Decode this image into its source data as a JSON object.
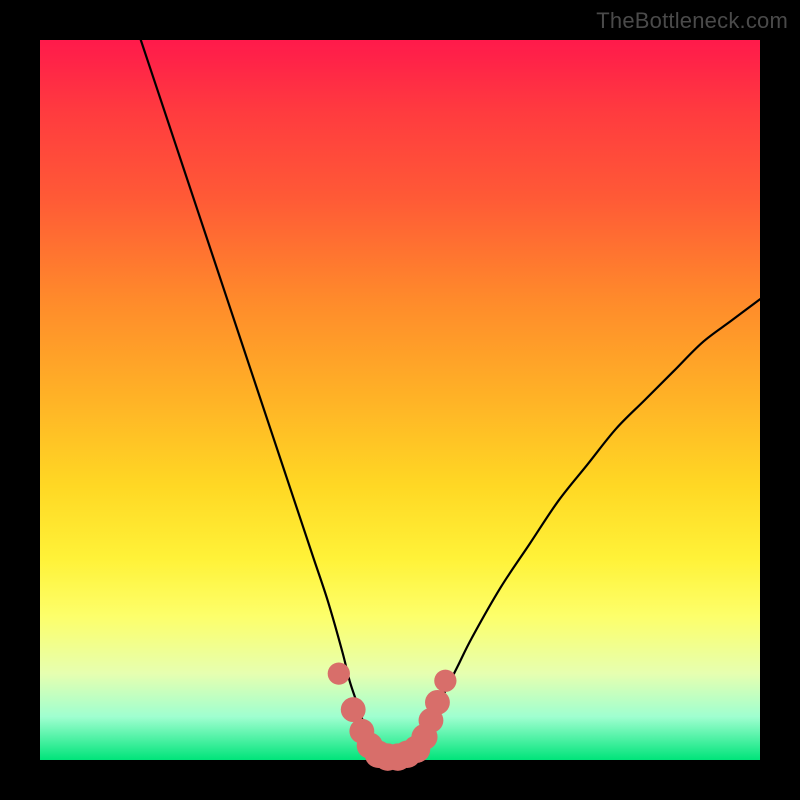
{
  "watermark": "TheBottleneck.com",
  "colors": {
    "background": "#000000",
    "curve": "#000000",
    "marker_fill": "#d86e6a",
    "marker_stroke": "#c95b57"
  },
  "chart_data": {
    "type": "line",
    "title": "",
    "xlabel": "",
    "ylabel": "",
    "xlim": [
      0,
      100
    ],
    "ylim": [
      0,
      100
    ],
    "grid": false,
    "legend": false,
    "series": [
      {
        "name": "bottleneck-curve",
        "x": [
          14,
          16,
          18,
          20,
          22,
          24,
          26,
          28,
          30,
          32,
          34,
          36,
          38,
          40,
          42,
          43,
          44,
          45,
          46,
          47,
          48,
          49,
          50,
          51,
          52,
          53,
          54,
          56,
          58,
          60,
          64,
          68,
          72,
          76,
          80,
          84,
          88,
          92,
          96,
          100
        ],
        "y": [
          100,
          94,
          88,
          82,
          76,
          70,
          64,
          58,
          52,
          46,
          40,
          34,
          28,
          22,
          15,
          11,
          8,
          5,
          3,
          1.5,
          0.8,
          0.4,
          0.4,
          0.8,
          1.5,
          3,
          5,
          9,
          13,
          17,
          24,
          30,
          36,
          41,
          46,
          50,
          54,
          58,
          61,
          64
        ]
      }
    ],
    "markers": [
      {
        "x": 41.5,
        "y": 12,
        "r": 1.1
      },
      {
        "x": 43.5,
        "y": 7,
        "r": 1.3
      },
      {
        "x": 44.7,
        "y": 4,
        "r": 1.3
      },
      {
        "x": 45.8,
        "y": 2,
        "r": 1.4
      },
      {
        "x": 47,
        "y": 0.8,
        "r": 1.5
      },
      {
        "x": 48.3,
        "y": 0.4,
        "r": 1.5
      },
      {
        "x": 49.7,
        "y": 0.4,
        "r": 1.5
      },
      {
        "x": 51,
        "y": 0.8,
        "r": 1.5
      },
      {
        "x": 52.3,
        "y": 1.5,
        "r": 1.5
      },
      {
        "x": 53.4,
        "y": 3.2,
        "r": 1.4
      },
      {
        "x": 54.3,
        "y": 5.5,
        "r": 1.3
      },
      {
        "x": 55.2,
        "y": 8,
        "r": 1.3
      },
      {
        "x": 56.3,
        "y": 11,
        "r": 1.1
      }
    ]
  }
}
